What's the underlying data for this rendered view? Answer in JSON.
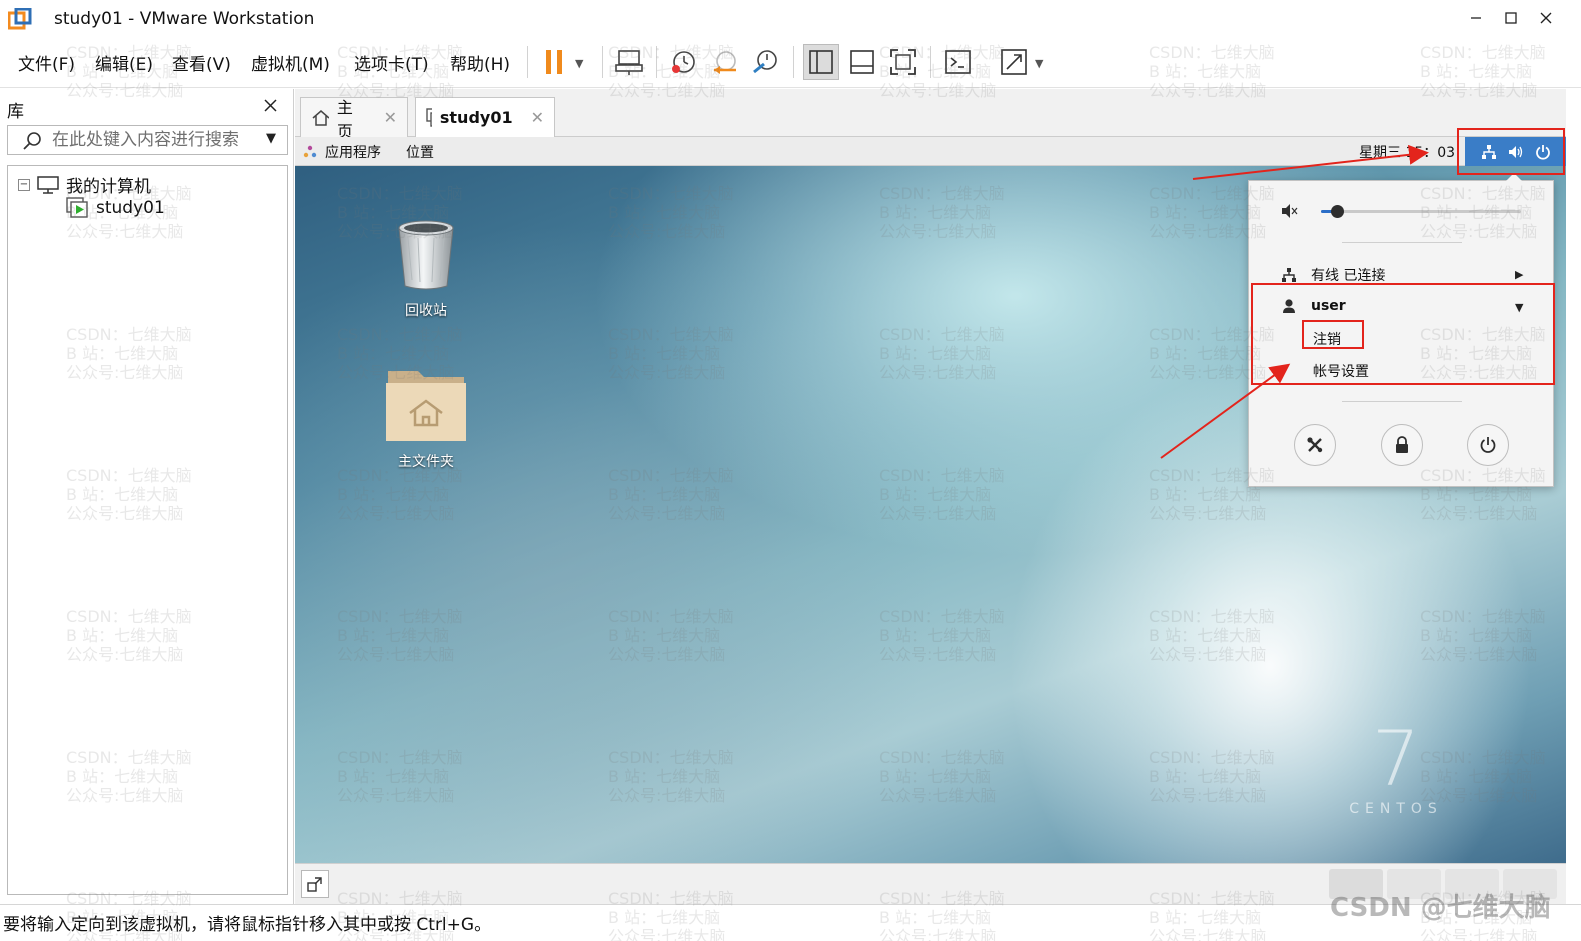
{
  "window": {
    "title": "study01 - VMware Workstation"
  },
  "menu": [
    "文件(F)",
    "编辑(E)",
    "查看(V)",
    "虚拟机(M)",
    "选项卡(T)",
    "帮助(H)"
  ],
  "library": {
    "title": "库",
    "search_placeholder": "在此处键入内容进行搜索",
    "tree": {
      "root": "我的计算机",
      "child": "study01"
    }
  },
  "tabs": [
    {
      "label": "主页",
      "active": false
    },
    {
      "label": "study01",
      "active": true
    }
  ],
  "guest": {
    "top_bar": {
      "applications": "应用程序",
      "places": "位置",
      "clock": "星期三 15：03"
    },
    "desktop_icons": [
      {
        "label": "回收站",
        "icon": "trash-icon"
      },
      {
        "label": "主文件夹",
        "icon": "home-folder-icon"
      }
    ],
    "system_menu": {
      "volume_level": 0.05,
      "network_label": "有线 已连接",
      "user_label": "user",
      "logout_label": "注销",
      "account_settings_label": "帐号设置"
    },
    "os_logo": {
      "number": "7",
      "name": "CENTOS"
    }
  },
  "status_bar": {
    "message": "要将输入定向到该虚拟机，请将鼠标指针移入其中或按 Ctrl+G。"
  },
  "watermark": {
    "line1": "CSDN：七维大脑",
    "line2": "B 站：七维大脑",
    "line3": "公众号:七维大脑",
    "corner": "CSDN @七维大脑"
  },
  "colors": {
    "annotation_red": "#e3241c",
    "status_area_blue": "#3a7dc7",
    "pause_orange": "#f08a1c"
  }
}
